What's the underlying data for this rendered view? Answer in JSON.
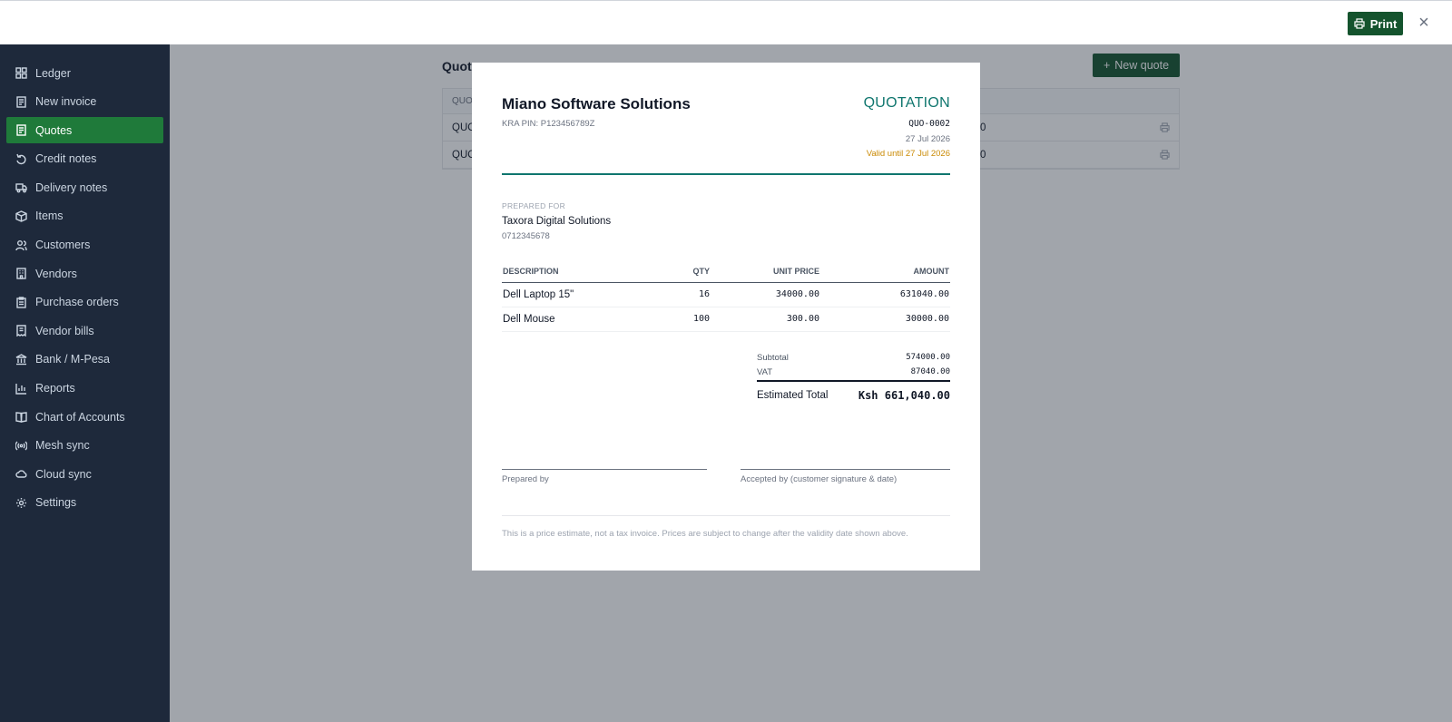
{
  "topbar": {
    "print_label": "Print",
    "close_icon": "×"
  },
  "sidebar": {
    "items": [
      {
        "label": "Ledger",
        "icon": "grid-icon"
      },
      {
        "label": "New invoice",
        "icon": "document-icon"
      },
      {
        "label": "Quotes",
        "icon": "document-icon",
        "active": true
      },
      {
        "label": "Credit notes",
        "icon": "undo-icon"
      },
      {
        "label": "Delivery notes",
        "icon": "truck-icon"
      },
      {
        "label": "Items",
        "icon": "box-icon"
      },
      {
        "label": "Customers",
        "icon": "users-icon"
      },
      {
        "label": "Vendors",
        "icon": "building-icon"
      },
      {
        "label": "Purchase orders",
        "icon": "clipboard-icon"
      },
      {
        "label": "Vendor bills",
        "icon": "receipt-icon"
      },
      {
        "label": "Bank / M-Pesa",
        "icon": "bank-icon"
      },
      {
        "label": "Reports",
        "icon": "bar-chart-icon"
      },
      {
        "label": "Chart of Accounts",
        "icon": "book-icon"
      },
      {
        "label": "Mesh sync",
        "icon": "broadcast-icon"
      },
      {
        "label": "Cloud sync",
        "icon": "cloud-icon"
      },
      {
        "label": "Settings",
        "icon": "gear-icon"
      }
    ]
  },
  "main": {
    "title": "Quote",
    "new_quote_label": "New quote",
    "table_header": "QUO",
    "rows": [
      {
        "left": "QUO",
        "right": "0"
      },
      {
        "left": "QUO",
        "right": "0"
      }
    ]
  },
  "quote": {
    "company": "Miano Software Solutions",
    "kra_pin": "KRA PIN: P123456789Z",
    "doc_title": "QUOTATION",
    "number": "QUO-0002",
    "date": "27 Jul 2026",
    "valid_until": "Valid until 27 Jul 2026",
    "prepared_for_label": "PREPARED FOR",
    "customer_name": "Taxora Digital Solutions",
    "customer_phone": "0712345678",
    "columns": {
      "description": "DESCRIPTION",
      "qty": "QTY",
      "unit_price": "UNIT PRICE",
      "amount": "AMOUNT"
    },
    "lines": [
      {
        "description": "Dell Laptop 15\"",
        "qty": "16",
        "unit_price": "34000.00",
        "amount": "631040.00"
      },
      {
        "description": "Dell Mouse",
        "qty": "100",
        "unit_price": "300.00",
        "amount": "30000.00"
      }
    ],
    "subtotal_label": "Subtotal",
    "subtotal": "574000.00",
    "vat_label": "VAT",
    "vat": "87040.00",
    "total_label": "Estimated Total",
    "total": "Ksh 661,040.00",
    "prepared_by_label": "Prepared by",
    "accepted_by_label": "Accepted by (customer signature & date)",
    "footnote": "This is a price estimate, not a tax invoice. Prices are subject to change after the validity date shown above."
  },
  "colors": {
    "brand_green": "#14532d",
    "sidebar_bg": "#1e293b",
    "active_item": "#1f7a3a",
    "accent_teal": "#0f766e",
    "valid_amber": "#ca8a04"
  }
}
